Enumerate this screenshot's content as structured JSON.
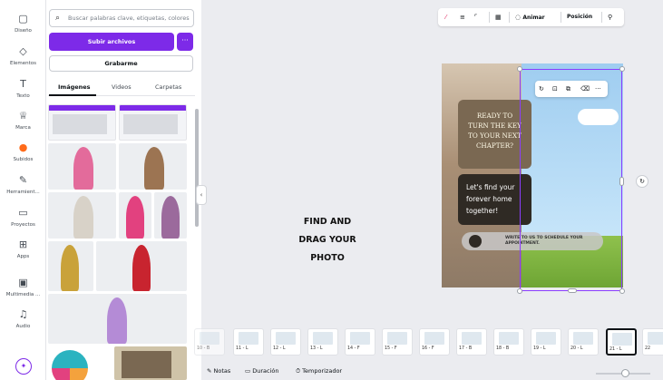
{
  "rail": {
    "items": [
      {
        "label": "Diseño",
        "icon": "layout-icon"
      },
      {
        "label": "Elementos",
        "icon": "shapes-icon"
      },
      {
        "label": "Texto",
        "icon": "text-icon"
      },
      {
        "label": "Marca",
        "icon": "brand-icon"
      },
      {
        "label": "Subidos",
        "icon": "cloud-upload-icon"
      },
      {
        "label": "Herramient...",
        "icon": "tools-icon"
      },
      {
        "label": "Proyectos",
        "icon": "folder-icon"
      },
      {
        "label": "Apps",
        "icon": "apps-icon"
      },
      {
        "label": "Multimedia ...",
        "icon": "photo-icon"
      },
      {
        "label": "Audio",
        "icon": "music-icon"
      }
    ],
    "active_index": 4,
    "assistant_glyph": "✦"
  },
  "panel": {
    "search_placeholder": "Buscar palabras clave, etiquetas, colores",
    "upload_label": "Subir archivos",
    "more_label": "···",
    "record_label": "Grabarme",
    "tabs": [
      "Imágenes",
      "Videos",
      "Carpetas"
    ],
    "active_tab": 0
  },
  "toolbar": {
    "animate_label": "Animar",
    "position_label": "Posición"
  },
  "canvas": {
    "instruction": [
      "FIND AND",
      "DRAG YOUR",
      "PHOTO"
    ],
    "design": {
      "card1_text": [
        "READY TO",
        "TURN THE KEY",
        "TO YOUR NEXT",
        "CHAPTER?"
      ],
      "card2_text": [
        "Let's find your",
        "forever home",
        "together!"
      ],
      "pill_text": [
        "WRITE TO US TO SCHEDULE YOUR",
        "APPOINTMENT."
      ]
    }
  },
  "pages": {
    "labels": [
      "10 - B",
      "11 - L",
      "12 - L",
      "13 - L",
      "14 - F",
      "15 - F",
      "16 - F",
      "17 - B",
      "18 - B",
      "19 - L",
      "20 - L",
      "21 - L",
      "22"
    ],
    "active_index": 11
  },
  "bottom_bar": {
    "notes_label": "Notas",
    "duration_label": "Duración",
    "timer_label": "Temporizador"
  },
  "colors": {
    "accent": "#7d2ae8",
    "selection": "#8b3dff",
    "canvas_bg": "#ebecf0"
  }
}
